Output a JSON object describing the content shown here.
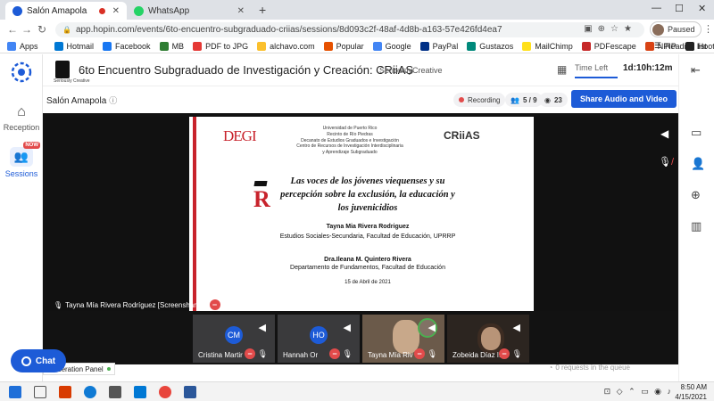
{
  "browser": {
    "tabs": [
      {
        "title": "Salón Amapola",
        "active": true
      },
      {
        "title": "WhatsApp",
        "active": false
      }
    ],
    "url": "app.hopin.com/events/6to-encuentro-subgraduado-criias/sessions/8d093c2f-48af-4d8b-a163-57e426fd4ea7",
    "profile_status": "Paused",
    "bookmarks": [
      {
        "label": "Apps",
        "color": "#4285f4"
      },
      {
        "label": "Hotmail",
        "color": "#0078d4"
      },
      {
        "label": "Facebook",
        "color": "#1877f2"
      },
      {
        "label": "MB",
        "color": "#2e7d32"
      },
      {
        "label": "PDF to JPG",
        "color": "#e53935"
      },
      {
        "label": "alchavo.com",
        "color": "#fbc02d"
      },
      {
        "label": "Popular",
        "color": "#e65100"
      },
      {
        "label": "Google",
        "color": "#4285f4"
      },
      {
        "label": "PayPal",
        "color": "#003087"
      },
      {
        "label": "Gustazos",
        "color": "#00897b"
      },
      {
        "label": "MailChimp",
        "color": "#ffe01b"
      },
      {
        "label": "PDFescape",
        "color": "#c62828"
      },
      {
        "label": "NPIP",
        "color": "#d84315"
      },
      {
        "label": "Hootsuite",
        "color": "#222222"
      }
    ],
    "reading_list": "Reading list"
  },
  "nav": {
    "reception": "Reception",
    "sessions": "Sessions",
    "now_badge": "NOW"
  },
  "event": {
    "title": "6to Encuentro Subgraduado de Investigación y Creación: CRiiAS",
    "org": "SeriouslyCreative",
    "logo_sub": "Seriously Creative",
    "time_left_label": "Time Left",
    "time_left": "1d:10h:12m"
  },
  "session": {
    "name": "Salón Amapola",
    "recording": "Recording",
    "participants": "5 / 9",
    "viewers": "23",
    "share_button": "Share Audio and Video"
  },
  "slide": {
    "deg_logo": "DEGI",
    "university_lines": "Universidad de Puerto Rico\nRecinto de Río Piedras\nDecanato de Estudios Graduados e Investigación\nCentro de Recursos de Investigación Interdisciplinaria\ny Aprendizaje Subgraduado",
    "criias_logo": "CRiiAS",
    "title": "Las voces de los jóvenes viequenses y su percepción sobre la exclusión, la educación y los juvenicidios",
    "author1": "Tayna Mia Rivera Rodriguez",
    "author1_aff": "Estudios Sociales-Secundaria, Facultad de Educación, UPRRP",
    "author2": "Dra.Ileana M. Quintero Rivera",
    "author2_aff": "Departamento de Fundamentos, Facultad de Educación",
    "date": "15 de Abril de 2021"
  },
  "screenshare_label": "Tayna Mía Rivera Rodríguez [Screenshare]",
  "participants": [
    {
      "initials": "CM",
      "name": "Cristina Martir",
      "type": "avatar"
    },
    {
      "initials": "HO",
      "name": "Hannah Or",
      "type": "avatar"
    },
    {
      "initials": "",
      "name": "Tayna Mía Riv",
      "type": "video1"
    },
    {
      "initials": "",
      "name": "Zobeida Díaz I.",
      "type": "video2"
    }
  ],
  "moderation_panel": "Moderation Panel",
  "queue_text": "0 requests in the queue",
  "chat_button": "Chat",
  "taskbar": {
    "time": "8:50 AM",
    "date": "4/15/2021"
  },
  "colors": {
    "brand_blue": "#1d5bd7",
    "recording_red": "#e24b4b",
    "slide_red": "#c8232c"
  }
}
